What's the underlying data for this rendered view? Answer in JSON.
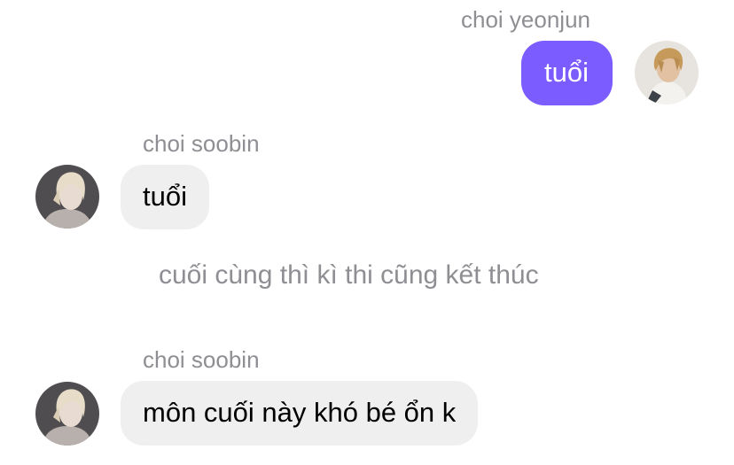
{
  "messages": [
    {
      "sender": "choi yeonjun",
      "text": "tuổi",
      "direction": "outgoing",
      "bubble_color": "#7b5cff"
    },
    {
      "sender": "choi soobin",
      "text": "tuổi",
      "direction": "incoming",
      "bubble_color": "#efefef"
    },
    {
      "system_text": "cuối cùng thì kì thi cũng kết thúc"
    },
    {
      "sender": "choi soobin",
      "text": "môn cuối này khó bé ổn k",
      "direction": "incoming",
      "bubble_color": "#efefef"
    }
  ],
  "colors": {
    "outgoing_bubble": "#7b5cff",
    "incoming_bubble": "#efefef",
    "meta_text": "#8e8e93"
  }
}
